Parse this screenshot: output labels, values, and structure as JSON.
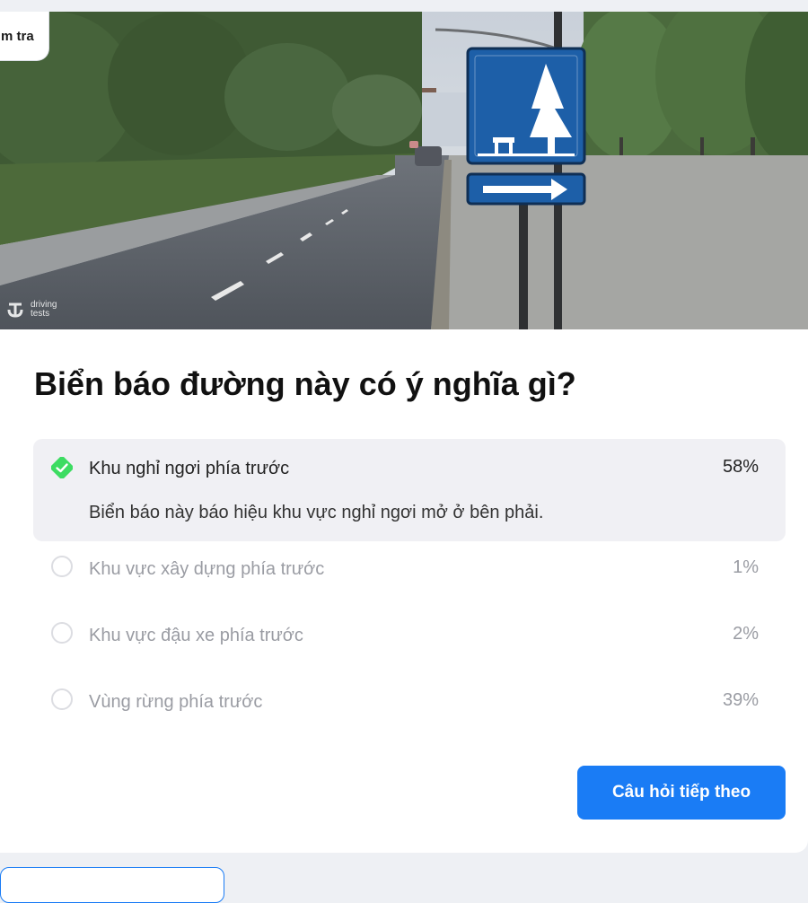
{
  "tag": {
    "label": "m tra"
  },
  "logo": {
    "line1": "driving",
    "line2": "tests"
  },
  "question": "Biển báo đường này có ý nghĩa gì?",
  "answers": [
    {
      "label": "Khu nghỉ ngơi phía trước",
      "percent": "58%",
      "state": "correct",
      "explanation": "Biển báo này báo hiệu khu vực nghỉ ngơi mở ở bên phải."
    },
    {
      "label": "Khu vực xây dựng phía trước",
      "percent": "1%",
      "state": "unselected"
    },
    {
      "label": "Khu vực đậu xe phía trước",
      "percent": "2%",
      "state": "unselected"
    },
    {
      "label": "Vùng rừng phía trước",
      "percent": "39%",
      "state": "unselected"
    }
  ],
  "next_button": {
    "label": "Câu hỏi tiếp theo"
  },
  "colors": {
    "accent": "#1a7cf5",
    "correct": "#3ddc62",
    "sign_blue": "#1d5fa8"
  },
  "icons": {
    "correct": "check-diamond-icon",
    "unselected": "radio-circle-icon",
    "logo": "driving-tests-logo-icon"
  }
}
